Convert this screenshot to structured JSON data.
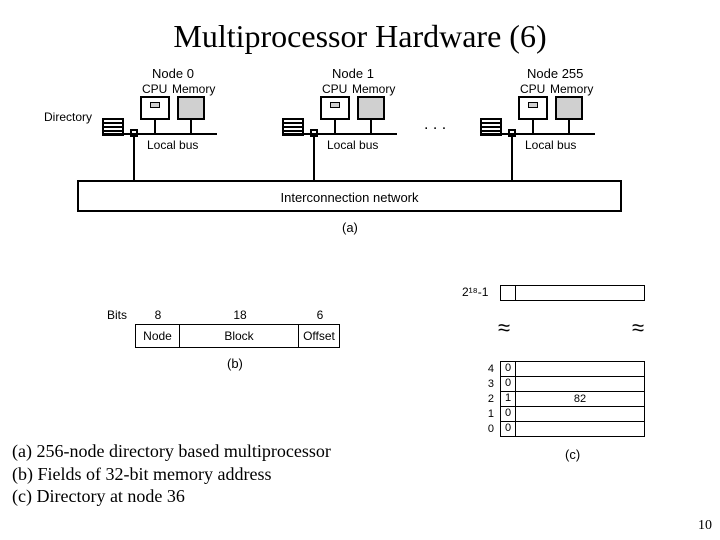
{
  "title": "Multiprocessor Hardware (6)",
  "diagram_a": {
    "directory_label": "Directory",
    "local_bus_label": "Local bus",
    "cpu_label": "CPU",
    "memory_label": "Memory",
    "interconnect_label": "Interconnection network",
    "ellipsis": ". . .",
    "fig_label": "(a)",
    "nodes": [
      {
        "label": "Node 0"
      },
      {
        "label": "Node 1"
      },
      {
        "label": "Node 255"
      }
    ]
  },
  "diagram_b": {
    "bits_label": "Bits",
    "fig_label": "(b)",
    "fields": [
      {
        "name": "Node",
        "bits": "8"
      },
      {
        "name": "Block",
        "bits": "18"
      },
      {
        "name": "Offset",
        "bits": "6"
      }
    ]
  },
  "diagram_c": {
    "top_label": "2¹⁸-1",
    "fig_label": "(c)",
    "rows": [
      {
        "idx": "4",
        "flag": "0",
        "val": ""
      },
      {
        "idx": "3",
        "flag": "0",
        "val": ""
      },
      {
        "idx": "2",
        "flag": "1",
        "val": "82"
      },
      {
        "idx": "1",
        "flag": "0",
        "val": ""
      },
      {
        "idx": "0",
        "flag": "0",
        "val": ""
      }
    ]
  },
  "captions": {
    "line1": "(a) 256-node directory based multiprocessor",
    "line2": "(b) Fields of 32-bit memory address",
    "line3": "(c) Directory at node 36"
  },
  "page_number": "10"
}
